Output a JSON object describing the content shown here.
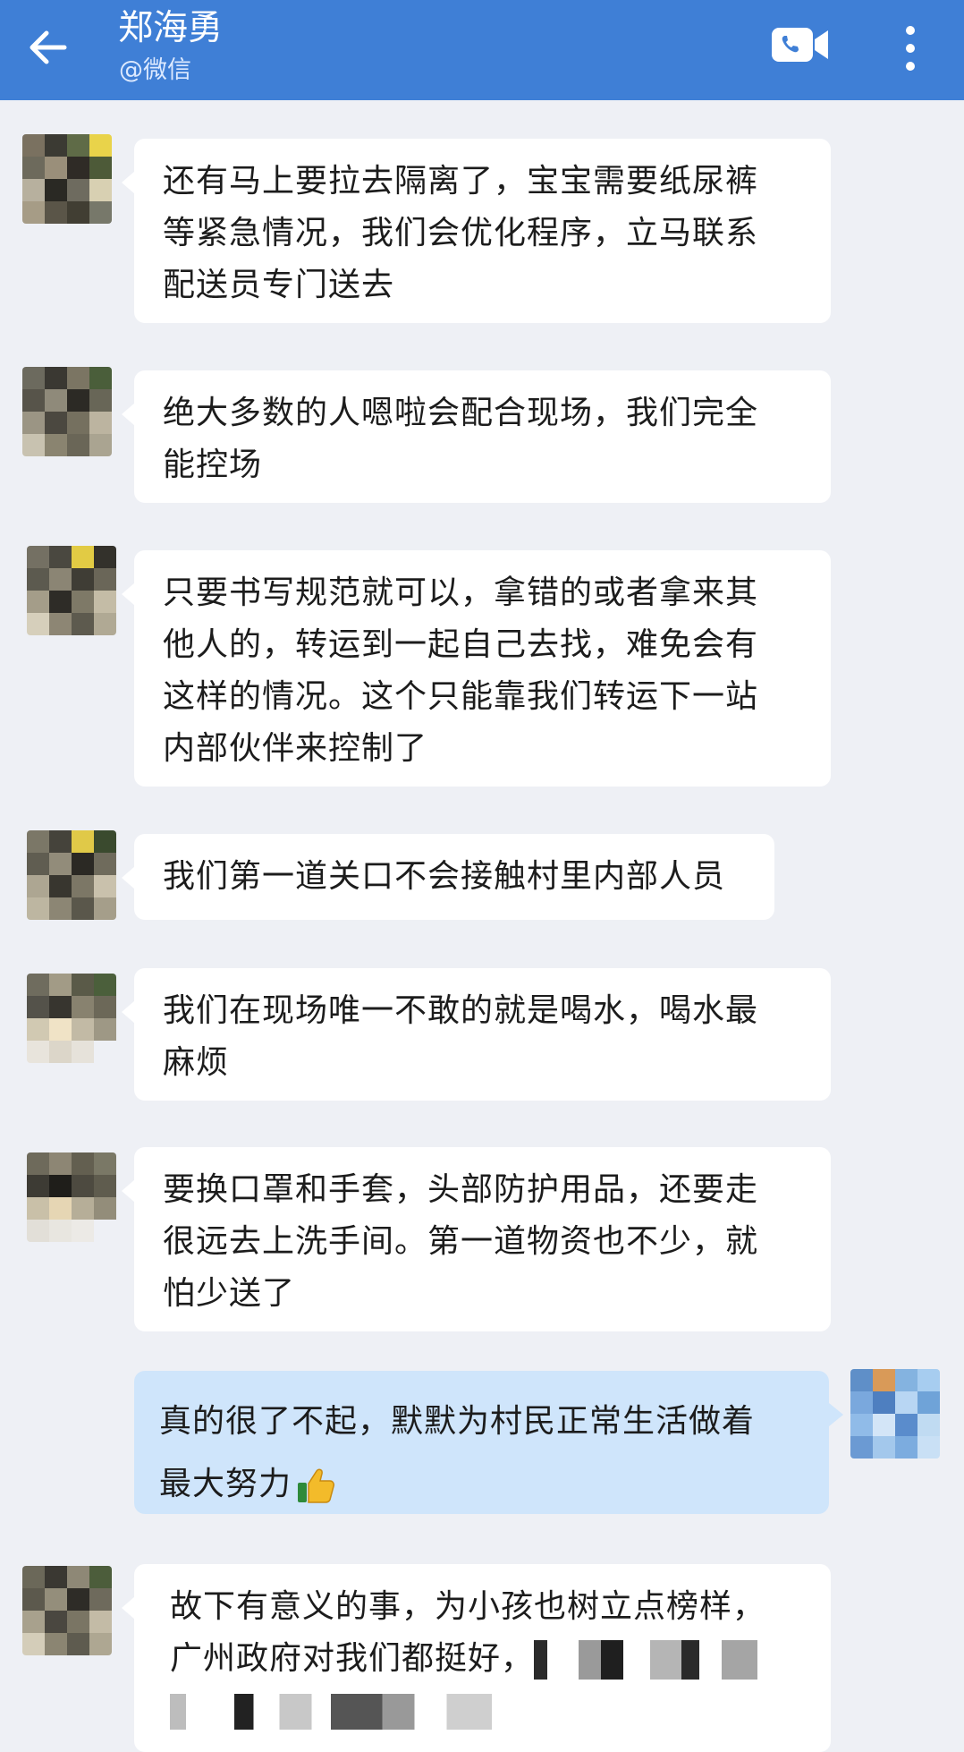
{
  "header": {
    "contact_name": "郑海勇",
    "source": "@微信",
    "back_icon": "arrow-left-icon",
    "call_icon": "video-call-icon",
    "menu_icon": "more-vertical-icon"
  },
  "messages": [
    {
      "from": "other",
      "lines": [
        "还有马上要拉去隔离了，宝宝需要纸尿裤",
        "等紧急情况，我们会优化程序，立马联系",
        "配送员专门送去"
      ]
    },
    {
      "from": "other",
      "lines": [
        "绝大多数的人嗯啦会配合现场，我们完全",
        "能控场"
      ]
    },
    {
      "from": "other",
      "lines": [
        "只要书写规范就可以，拿错的或者拿来其",
        "他人的，转运到一起自己去找，难免会有",
        "这样的情况。这个只能靠我们转运下一站",
        "内部伙伴来控制了"
      ]
    },
    {
      "from": "other",
      "lines": [
        "我们第一道关口不会接触村里内部人员"
      ]
    },
    {
      "from": "other",
      "lines": [
        "我们在现场唯一不敢的就是喝水，喝水最",
        "麻烦"
      ]
    },
    {
      "from": "other",
      "lines": [
        "要换口罩和手套，头部防护用品，还要走",
        "很远去上洗手间。第一道物资也不少，就",
        "怕少送了"
      ]
    },
    {
      "from": "self",
      "lines": [
        "真的很了不起，默默为村民正常生活做着",
        "最大努力"
      ],
      "emoji": "thumbs-up-icon"
    },
    {
      "from": "other",
      "lines": [
        "故下有意义的事，为小孩也树立点榜样，",
        "广州政府对我们都挺好，"
      ]
    }
  ],
  "colors": {
    "header": "#3f7fd6",
    "background": "#eef0f5",
    "bubble_other": "#ffffff",
    "bubble_self": "#cfe5fb"
  }
}
